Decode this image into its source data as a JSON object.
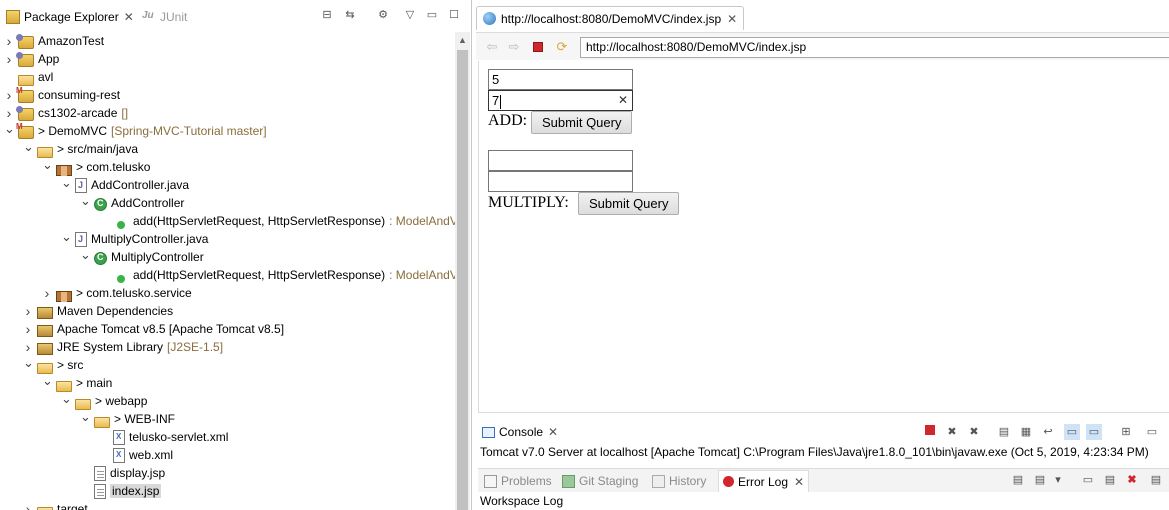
{
  "left_panel": {
    "tabs": [
      {
        "label": "Package Explorer",
        "active": true
      },
      {
        "label": "JUnit",
        "active": false
      }
    ],
    "tree": [
      {
        "label": "AmazonTest",
        "decoration": "",
        "depth": 0,
        "twisty": "collapsed",
        "icon": "project-icon"
      },
      {
        "label": "App",
        "decoration": "",
        "depth": 0,
        "twisty": "collapsed",
        "icon": "project-icon"
      },
      {
        "label": "avl",
        "decoration": "",
        "depth": 0,
        "twisty": "none",
        "icon": "folder-icon"
      },
      {
        "label": "consuming-rest",
        "decoration": "",
        "depth": 0,
        "twisty": "collapsed",
        "icon": "maven-project-icon"
      },
      {
        "label": "cs1302-arcade",
        "decoration": "[]",
        "depth": 0,
        "twisty": "collapsed",
        "icon": "project-icon"
      },
      {
        "label": "> DemoMVC",
        "decoration": "[Spring-MVC-Tutorial master]",
        "depth": 0,
        "twisty": "expanded",
        "icon": "maven-project-icon"
      },
      {
        "label": "> src/main/java",
        "decoration": "",
        "depth": 1,
        "twisty": "expanded",
        "icon": "source-folder-icon"
      },
      {
        "label": "> com.telusko",
        "decoration": "",
        "depth": 2,
        "twisty": "expanded",
        "icon": "package-icon"
      },
      {
        "label": "AddController.java",
        "decoration": "",
        "depth": 3,
        "twisty": "expanded",
        "icon": "java-file-icon"
      },
      {
        "label": "AddController",
        "decoration": "",
        "depth": 4,
        "twisty": "expanded",
        "icon": "class-icon"
      },
      {
        "label": "add(HttpServletRequest, HttpServletResponse)",
        "decoration": ": ModelAndV",
        "depth": 5,
        "twisty": "none",
        "icon": "method-icon"
      },
      {
        "label": "MultiplyController.java",
        "decoration": "",
        "depth": 3,
        "twisty": "expanded",
        "icon": "java-file-icon"
      },
      {
        "label": "MultiplyController",
        "decoration": "",
        "depth": 4,
        "twisty": "expanded",
        "icon": "class-icon"
      },
      {
        "label": "add(HttpServletRequest, HttpServletResponse)",
        "decoration": ": ModelAndV",
        "depth": 5,
        "twisty": "none",
        "icon": "method-icon"
      },
      {
        "label": "> com.telusko.service",
        "decoration": "",
        "depth": 2,
        "twisty": "collapsed",
        "icon": "package-icon"
      },
      {
        "label": "Maven Dependencies",
        "decoration": "",
        "depth": 1,
        "twisty": "collapsed",
        "icon": "library-icon"
      },
      {
        "label": "Apache Tomcat v8.5 [Apache Tomcat v8.5]",
        "decoration": "",
        "depth": 1,
        "twisty": "collapsed",
        "icon": "library-icon"
      },
      {
        "label": "JRE System Library",
        "decoration": "[J2SE-1.5]",
        "depth": 1,
        "twisty": "collapsed",
        "icon": "library-icon"
      },
      {
        "label": "> src",
        "decoration": "",
        "depth": 1,
        "twisty": "expanded",
        "icon": "folder-icon"
      },
      {
        "label": "> main",
        "decoration": "",
        "depth": 2,
        "twisty": "expanded",
        "icon": "folder-icon"
      },
      {
        "label": "> webapp",
        "decoration": "",
        "depth": 3,
        "twisty": "expanded",
        "icon": "folder-icon"
      },
      {
        "label": "> WEB-INF",
        "decoration": "",
        "depth": 4,
        "twisty": "expanded",
        "icon": "folder-icon"
      },
      {
        "label": "telusko-servlet.xml",
        "decoration": "",
        "depth": 5,
        "twisty": "none",
        "icon": "xml-file-icon"
      },
      {
        "label": "web.xml",
        "decoration": "",
        "depth": 5,
        "twisty": "none",
        "icon": "xml-file-icon"
      },
      {
        "label": "display.jsp",
        "decoration": "",
        "depth": 4,
        "twisty": "none",
        "icon": "jsp-file-icon"
      },
      {
        "label": "index.jsp",
        "decoration": "",
        "depth": 4,
        "twisty": "none",
        "icon": "jsp-file-icon",
        "selected": true
      },
      {
        "label": "target",
        "decoration": "",
        "depth": 1,
        "twisty": "collapsed",
        "icon": "folder-icon"
      }
    ]
  },
  "browser": {
    "tab_title": "http://localhost:8080/DemoMVC/index.jsp",
    "url": "http://localhost:8080/DemoMVC/index.jsp",
    "page": {
      "add_form": {
        "field1_value": "5",
        "field2_value": "7",
        "label": "ADD:",
        "button": "Submit Query"
      },
      "multiply_form": {
        "field1_value": "",
        "field2_value": "",
        "label": "MULTIPLY:",
        "button": "Submit Query"
      }
    }
  },
  "console": {
    "tab_label": "Console",
    "status": "Tomcat v7.0 Server at localhost [Apache Tomcat] C:\\Program Files\\Java\\jre1.8.0_101\\bin\\javaw.exe (Oct 5, 2019, 4:23:34 PM)"
  },
  "bottom_views": {
    "tabs": [
      {
        "label": "Problems",
        "active": false
      },
      {
        "label": "Git Staging",
        "active": false
      },
      {
        "label": "History",
        "active": false
      },
      {
        "label": "Error Log",
        "active": true
      }
    ],
    "content_label": "Workspace Log"
  },
  "colors": {
    "decoration": "#8a6d3b",
    "selection": "#d9d9d9",
    "stop_red": "#d0262c"
  }
}
